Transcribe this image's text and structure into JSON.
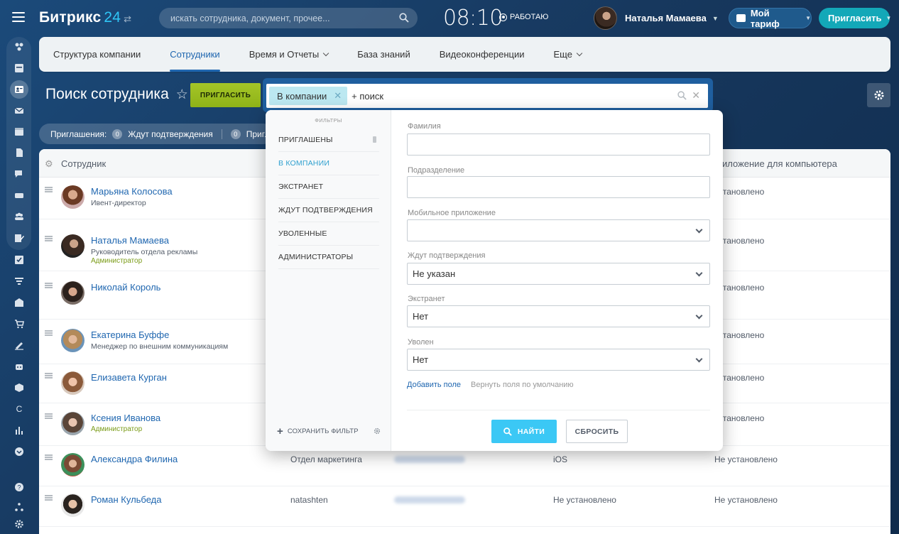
{
  "header": {
    "logo_text": "Битрикс",
    "logo_num": "24",
    "search_placeholder": "искать сотрудника, документ, прочее...",
    "clock": "08:10",
    "work_status": "РАБОТАЮ",
    "user_name": "Наталья Мамаева",
    "tariff_label": "Мой тариф",
    "invite_label": "Пригласить"
  },
  "nav": {
    "tabs": [
      {
        "label": "Структура компании"
      },
      {
        "label": "Сотрудники"
      },
      {
        "label": "Время и Отчеты"
      },
      {
        "label": "База знаний"
      },
      {
        "label": "Видеоконференции"
      },
      {
        "label": "Еще"
      }
    ]
  },
  "page": {
    "title": "Поиск сотрудника",
    "invite_button": "ПРИГЛАСИТЬ",
    "filter_tag": "В компании",
    "add_search": "+ поиск"
  },
  "invitations": {
    "label": "Приглашения:",
    "waiting_count": "0",
    "waiting_label": "Ждут подтверждения",
    "second_count": "0",
    "second_label": "Пригл"
  },
  "table": {
    "col_employee": "Сотрудник",
    "col_desktop": "иложение для компьютера",
    "rows": [
      {
        "name": "Марьяна Колосова",
        "position": "Ивент-директор",
        "admin": "",
        "dept": "",
        "mobile": "",
        "desktop": "установлено"
      },
      {
        "name": "Наталья Мамаева",
        "position": "Руководитель отдела рекламы",
        "admin": "Администратор",
        "dept": "",
        "mobile": "",
        "desktop": "установлено"
      },
      {
        "name": "Николай Король",
        "position": "",
        "admin": "",
        "dept": "",
        "mobile": "",
        "desktop": "установлено"
      },
      {
        "name": "Екатерина Буффе",
        "position": "Менеджер по внешним коммуникациям",
        "admin": "",
        "dept": "",
        "mobile": "",
        "desktop": "установлено"
      },
      {
        "name": "Елизавета Курган",
        "position": "",
        "admin": "",
        "dept": "",
        "mobile": "",
        "desktop": "установлено"
      },
      {
        "name": "Ксения Иванова",
        "position": "",
        "admin": "Администратор",
        "dept": "",
        "mobile": "",
        "desktop": "установлено"
      },
      {
        "name": "Александра Филина",
        "position": "",
        "admin": "",
        "dept": "Отдел маркетинга",
        "mobile": "iOS",
        "desktop": "Не установлено"
      },
      {
        "name": "Роман Кульбеда",
        "position": "",
        "admin": "",
        "dept": "natashten",
        "mobile": "Не установлено",
        "desktop": "Не установлено"
      }
    ]
  },
  "filter_popup": {
    "sidebar_title": "ФИЛЬТРЫ",
    "presets": [
      {
        "label": "ПРИГЛАШЕНЫ"
      },
      {
        "label": "В КОМПАНИИ"
      },
      {
        "label": "ЭКСТРАНЕТ"
      },
      {
        "label": "ЖДУТ ПОДТВЕРЖДЕНИЯ"
      },
      {
        "label": "УВОЛЕННЫЕ"
      },
      {
        "label": "АДМИНИСТРАТОРЫ"
      }
    ],
    "save_filter": "СОХРАНИТЬ ФИЛЬТР",
    "fields": [
      {
        "label": "Фамилия",
        "value": ""
      },
      {
        "label": "Подразделение",
        "value": ""
      },
      {
        "label": "Мобильное приложение",
        "value": ""
      },
      {
        "label": "Ждут подтверждения",
        "value": "Не указан"
      },
      {
        "label": "Экстранет",
        "value": "Нет"
      },
      {
        "label": "Уволен",
        "value": "Нет"
      }
    ],
    "add_field": "Добавить поле",
    "reset_fields": "Вернуть поля по умолчанию",
    "find_button": "НАЙТИ",
    "reset_button": "СБРОСИТЬ"
  },
  "colors": {
    "accent": "#2fc6f6",
    "link": "#2067b0",
    "invite_green": "#9cbf23",
    "find_blue": "#3bc8f5"
  }
}
